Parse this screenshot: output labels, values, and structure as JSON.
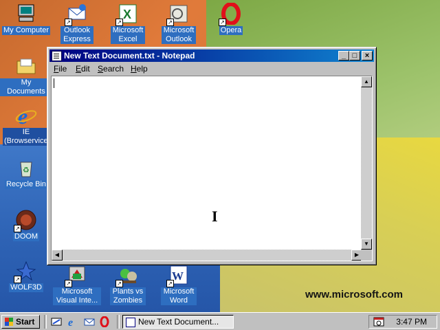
{
  "desktop": {
    "icons": [
      {
        "label": "My Computer"
      },
      {
        "label": "Outlook Express"
      },
      {
        "label": "Microsoft Excel"
      },
      {
        "label": "Microsoft Outlook"
      },
      {
        "label": "Opera"
      },
      {
        "label": "My Documents"
      },
      {
        "label": "IE (Browservice)"
      },
      {
        "label": "Recycle Bin"
      },
      {
        "label": "DOOM"
      },
      {
        "label": "WOLF3D"
      },
      {
        "label": "Microsoft Visual Inte..."
      },
      {
        "label": "Plants vs Zombies"
      },
      {
        "label": "Microsoft Word"
      }
    ],
    "wallpaper_text": "www.microsoft.com"
  },
  "notepad": {
    "title": "New Text Document.txt - Notepad",
    "menu": [
      {
        "label": "File",
        "accel": "F",
        "rest": "ile"
      },
      {
        "label": "Edit",
        "accel": "E",
        "rest": "dit"
      },
      {
        "label": "Search",
        "accel": "S",
        "rest": "earch"
      },
      {
        "label": "Help",
        "accel": "H",
        "rest": "elp"
      }
    ],
    "content": "",
    "caption_buttons": {
      "minimize": "_",
      "maximize": "□",
      "close": "×"
    }
  },
  "taskbar": {
    "start_label": "Start",
    "task_button_label": "New Text Document...",
    "clock": "3:47 PM"
  }
}
